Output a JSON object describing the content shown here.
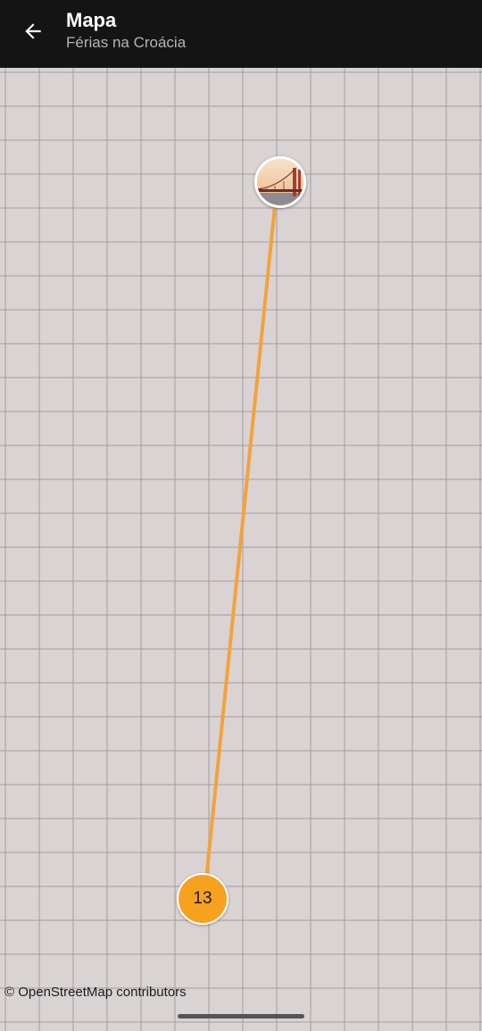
{
  "app_bar": {
    "title": "Mapa",
    "subtitle": "Férias na Croácia",
    "back_icon": "arrow-left-icon"
  },
  "map": {
    "route_color": "#f2a33a",
    "photo_marker": {
      "icon": "bridge-photo-thumbnail"
    },
    "cluster_marker": {
      "count": "13",
      "color": "#f7a21e"
    },
    "attribution": "© OpenStreetMap contributors"
  },
  "colors": {
    "app_bar": "#141414",
    "map_background": "#d9d3d3"
  }
}
